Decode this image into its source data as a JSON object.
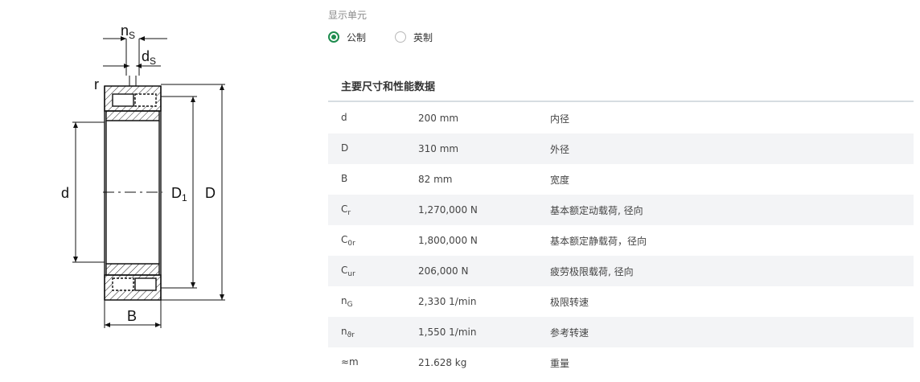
{
  "drawing": {
    "labels": {
      "ns_main": "n",
      "ns_sub": "S",
      "ds_main": "d",
      "ds_sub": "S",
      "r": "r",
      "d": "d",
      "D1_main": "D",
      "D1_sub": "1",
      "D": "D",
      "B": "B"
    }
  },
  "units": {
    "label": "显示单元",
    "options": [
      {
        "label": "公制",
        "selected": true
      },
      {
        "label": "英制",
        "selected": false
      }
    ]
  },
  "specs": {
    "title": "主要尺寸和性能数据",
    "rows": [
      {
        "sym": "d",
        "sub": "",
        "value": "200 mm",
        "desc": "内径"
      },
      {
        "sym": "D",
        "sub": "",
        "value": "310 mm",
        "desc": "外径"
      },
      {
        "sym": "B",
        "sub": "",
        "value": "82 mm",
        "desc": "宽度"
      },
      {
        "sym": "C",
        "sub": "r",
        "value": "1,270,000 N",
        "desc": "基本额定动载荷, 径向"
      },
      {
        "sym": "C",
        "sub": "0r",
        "value": "1,800,000 N",
        "desc": "基本额定静载荷，径向"
      },
      {
        "sym": "C",
        "sub": "ur",
        "value": "206,000 N",
        "desc": "疲劳极限载荷, 径向"
      },
      {
        "sym": "n",
        "sub": "G",
        "value": "2,330 1/min",
        "desc": "极限转速"
      },
      {
        "sym": "n",
        "sub": "ϑr",
        "value": "1,550 1/min",
        "desc": "参考转速"
      },
      {
        "sym": "≈m",
        "sub": "",
        "value": "21.628 kg",
        "desc": "重量"
      }
    ]
  },
  "colors": {
    "accent": "#1e8c4e",
    "row_alt": "#f3f4f6",
    "rule": "#d6dde1"
  }
}
